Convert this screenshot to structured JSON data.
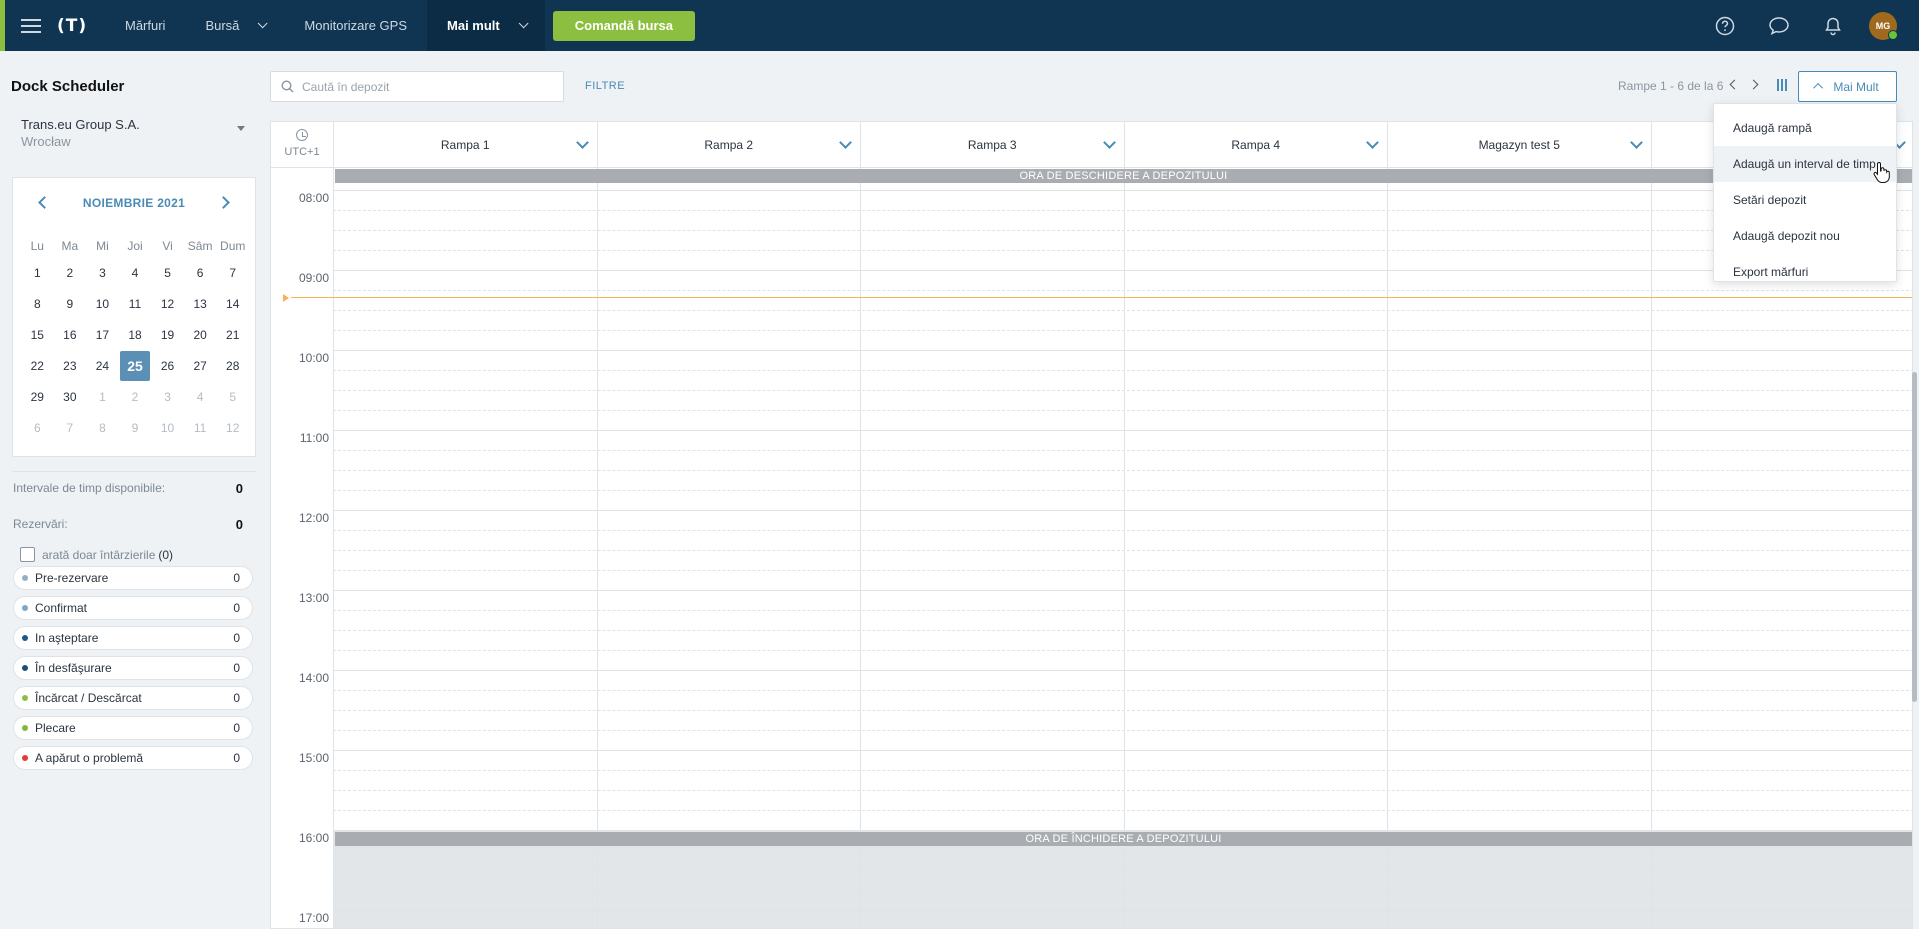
{
  "topbar": {
    "logo": "(T)",
    "nav": [
      {
        "label": "Mărfuri",
        "dropdown": false,
        "active": false
      },
      {
        "label": "Bursă",
        "dropdown": true,
        "active": false
      },
      {
        "label": "Monitorizare GPS",
        "dropdown": false,
        "active": false
      },
      {
        "label": "Mai mult",
        "dropdown": true,
        "active": true
      }
    ],
    "cta": "Comandă bursa",
    "avatar_initials": "MG",
    "icons": [
      "help-icon",
      "chat-icon",
      "bell-icon"
    ],
    "brand_color": "#0f3552",
    "accent_color": "#8cbf3f"
  },
  "sidebar": {
    "title": "Dock Scheduler",
    "company": {
      "name": "Trans.eu Group S.A.",
      "city": "Wrocław"
    },
    "calendar": {
      "month_label": "NOIEMBRIE 2021",
      "weekdays": [
        "Lu",
        "Ma",
        "Mi",
        "Joi",
        "Vi",
        "Sâm",
        "Dum"
      ],
      "weeks": [
        [
          "1",
          "2",
          "3",
          "4",
          "5",
          "6",
          "7"
        ],
        [
          "8",
          "9",
          "10",
          "11",
          "12",
          "13",
          "14"
        ],
        [
          "15",
          "16",
          "17",
          "18",
          "19",
          "20",
          "21"
        ],
        [
          "22",
          "23",
          "24",
          "25",
          "26",
          "27",
          "28"
        ],
        [
          "29",
          "30",
          "1",
          "2",
          "3",
          "4",
          "5"
        ],
        [
          "6",
          "7",
          "8",
          "9",
          "10",
          "11",
          "12"
        ]
      ],
      "selected": "25"
    },
    "stats": [
      {
        "label": "Intervale de timp disponibile:",
        "value": "0"
      },
      {
        "label": "Rezervări:",
        "value": "0"
      }
    ],
    "delays_checkbox": {
      "label": "arată doar întârzierile",
      "count": "(0)",
      "checked": false
    },
    "statuses": [
      {
        "label": "Pre-rezervare",
        "count": "0",
        "color": "#8fb0c9"
      },
      {
        "label": "Confirmat",
        "count": "0",
        "color": "#7aa7c7"
      },
      {
        "label": "In aşteptare",
        "count": "0",
        "color": "#1f5a86"
      },
      {
        "label": "În desfăşurare",
        "count": "0",
        "color": "#1a4f7a"
      },
      {
        "label": "Încărcat / Descărcat",
        "count": "0",
        "color": "#8cbf3f"
      },
      {
        "label": "Plecare",
        "count": "0",
        "color": "#7fb83a"
      },
      {
        "label": "A apărut o problemă",
        "count": "0",
        "color": "#e53935"
      }
    ]
  },
  "toolbar": {
    "search_placeholder": "Caută în depozit",
    "filters_label": "FILTRE",
    "pager_text": "Rampe 1 - 6 de la 6",
    "more_label": "Mai Mult"
  },
  "schedule": {
    "timezone": "UTC+1",
    "columns": [
      "Rampa 1",
      "Rampa 2",
      "Rampa 3",
      "Rampa 4",
      "Magazyn test 5",
      ""
    ],
    "hours": [
      "08:00",
      "09:00",
      "10:00",
      "11:00",
      "12:00",
      "13:00",
      "14:00",
      "15:00",
      "16:00",
      "17:00"
    ],
    "opening_label": "ORA DE DESCHIDERE A DEPOZITULUI",
    "closing_label": "ORA DE ÎNCHIDERE A DEPOZITULUI",
    "now_color": "#f4b25b"
  },
  "menu": {
    "items": [
      "Adaugă rampă",
      "Adaugă un interval de timp",
      "Setări depozit",
      "Adaugă depozit nou",
      "Export mărfuri"
    ],
    "hovered_index": 1
  }
}
